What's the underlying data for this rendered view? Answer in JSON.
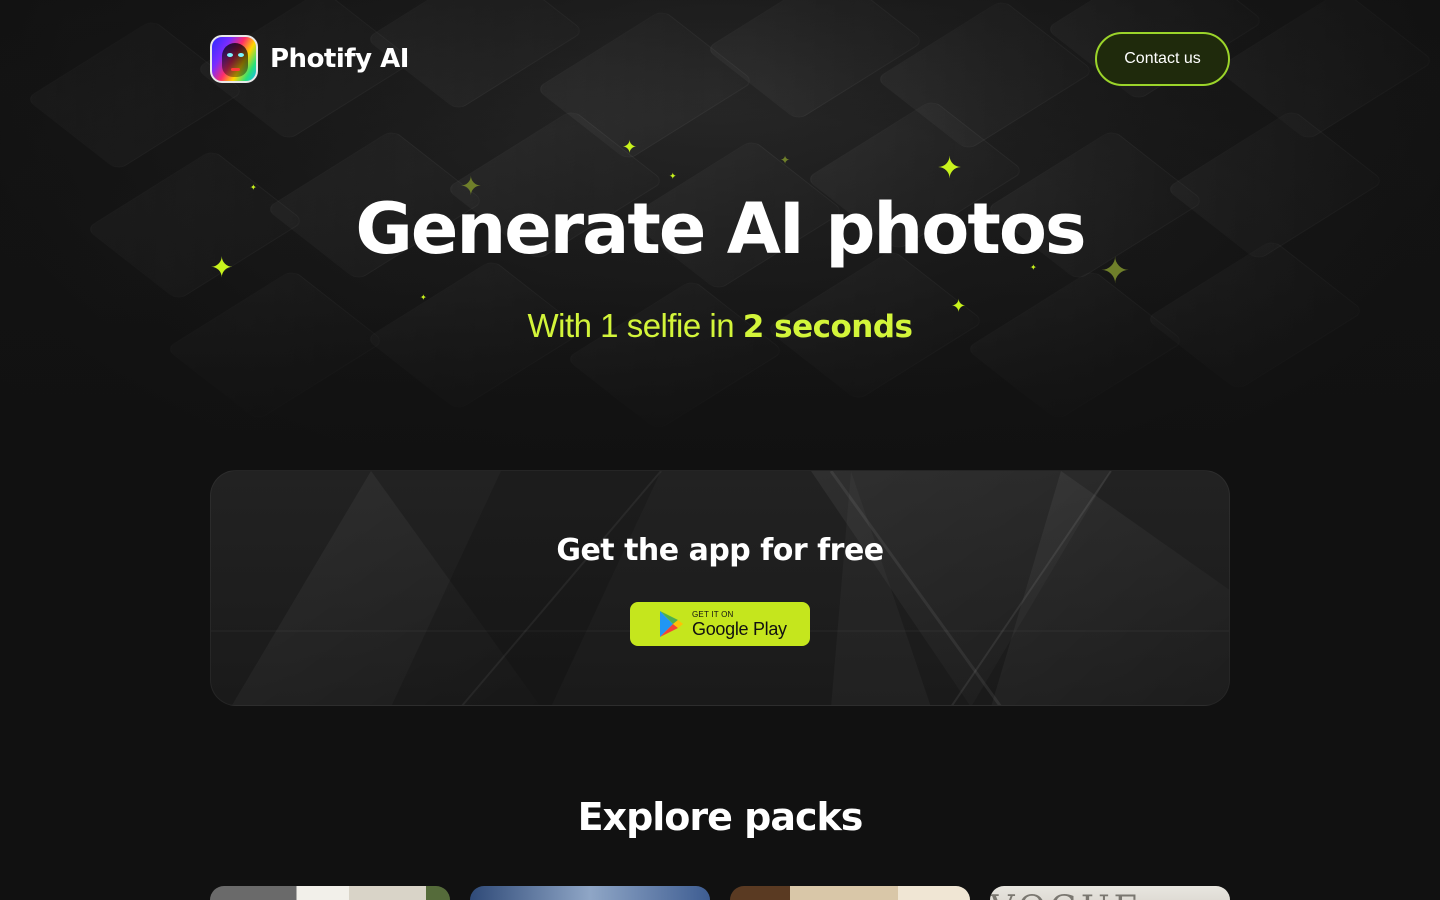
{
  "brand": {
    "name": "Photify AI"
  },
  "header": {
    "contact_label": "Contact us"
  },
  "hero": {
    "title": "Generate AI photos",
    "subtitle_prefix": "With 1 selfie in ",
    "subtitle_highlight": "2 seconds"
  },
  "app_card": {
    "title": "Get the app for free",
    "store_badge": {
      "small": "GET IT ON",
      "big": "Google Play"
    }
  },
  "explore": {
    "title": "Explore packs",
    "packs": [
      {
        "id": "pack-1",
        "visible_text": ""
      },
      {
        "id": "pack-2",
        "visible_text": ""
      },
      {
        "id": "pack-3",
        "visible_text": ""
      },
      {
        "id": "pack-4",
        "visible_text": "VOGUE"
      }
    ]
  },
  "colors": {
    "accent": "#c8f31d",
    "background": "#111111",
    "contact_border": "#9bd42a",
    "badge_bg": "#c5e61d"
  },
  "icons": {
    "logo": "photify-face-logo",
    "sparkle": "four-point-star",
    "store": "google-play-icon"
  }
}
